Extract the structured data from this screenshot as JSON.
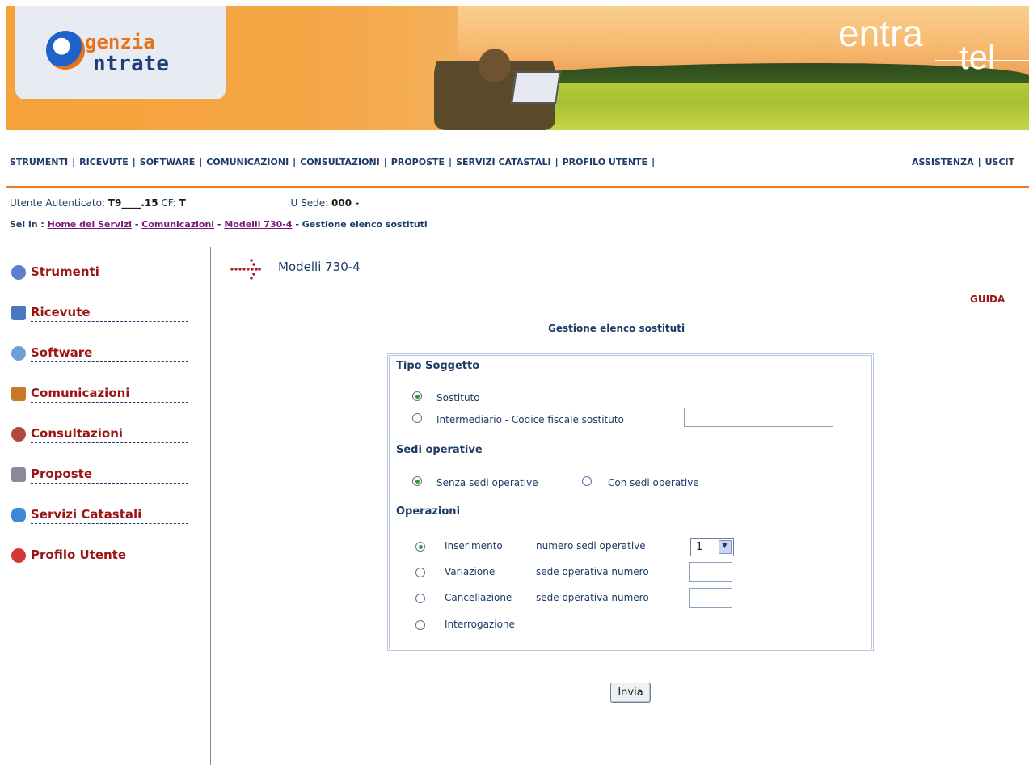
{
  "header": {
    "logo_line1": "genzia",
    "logo_line2": "ntrate",
    "brand_primary": "entra",
    "brand_secondary": "tel"
  },
  "top_nav": {
    "items": [
      "STRUMENTI",
      "RICEVUTE",
      "SOFTWARE",
      "COMUNICAZIONI",
      "CONSULTAZIONI",
      "PROPOSTE",
      "SERVIZI CATASTALI",
      "PROFILO UTENTE"
    ],
    "right_items": [
      "ASSISTENZA",
      "USCIT"
    ]
  },
  "user": {
    "label": "Utente Autenticato:",
    "id": "T9____.15",
    "cf_label": "CF:",
    "cf": "T",
    "sede_label": "Sede:",
    "sede_prefix": ":U",
    "sede": "000 -"
  },
  "breadcrumb": {
    "prefix": "Sei in :",
    "links": [
      "Home dei Servizi",
      "Comunicazioni",
      "Modelli 730-4"
    ],
    "current": "Gestione elenco sostituti"
  },
  "sidebar": {
    "items": [
      {
        "label": "Strumenti",
        "icon": "gear-icon",
        "color": "#5b7fc9"
      },
      {
        "label": "Ricevute",
        "icon": "receipt-icon",
        "color": "#4a78c0"
      },
      {
        "label": "Software",
        "icon": "software-icon",
        "color": "#6ea0d6"
      },
      {
        "label": "Comunicazioni",
        "icon": "briefcase-icon",
        "color": "#c7792a"
      },
      {
        "label": "Consultazioni",
        "icon": "lookup-icon",
        "color": "#b04a3a"
      },
      {
        "label": "Proposte",
        "icon": "board-icon",
        "color": "#8a8a9a"
      },
      {
        "label": "Servizi Catastali",
        "icon": "map-icon",
        "color": "#3a8ad8"
      },
      {
        "label": "Profilo Utente",
        "icon": "users-icon",
        "color": "#d23a3a"
      }
    ]
  },
  "main": {
    "title": "Modelli 730-4",
    "help_link": "GUIDA",
    "form_title": "Gestione elenco sostituti"
  },
  "form": {
    "tipo_soggetto": {
      "title": "Tipo Soggetto",
      "options": [
        "Sostituto",
        "Intermediario - Codice fiscale sostituto"
      ],
      "selected": "Sostituto",
      "codice_fiscale_value": ""
    },
    "sedi_operative": {
      "title": "Sedi operative",
      "options": [
        "Senza sedi operative",
        "Con sedi operative"
      ],
      "selected": "Senza sedi operative"
    },
    "operazioni": {
      "title": "Operazioni",
      "options": [
        {
          "label": "Inserimento",
          "field_label": "numero sedi operative"
        },
        {
          "label": "Variazione",
          "field_label": "sede operativa numero"
        },
        {
          "label": "Cancellazione",
          "field_label": "sede operativa numero"
        },
        {
          "label": "Interrogazione",
          "field_label": ""
        }
      ],
      "selected": "Inserimento",
      "numero_sedi_value": "1",
      "variazione_value": "",
      "cancellazione_value": ""
    },
    "submit_label": "Invia"
  },
  "colors": {
    "accent_orange": "#f07a24",
    "nav_blue": "#1c3b66",
    "link_red": "#9b1515",
    "breadcrumb_purple": "#7a1a7a"
  }
}
